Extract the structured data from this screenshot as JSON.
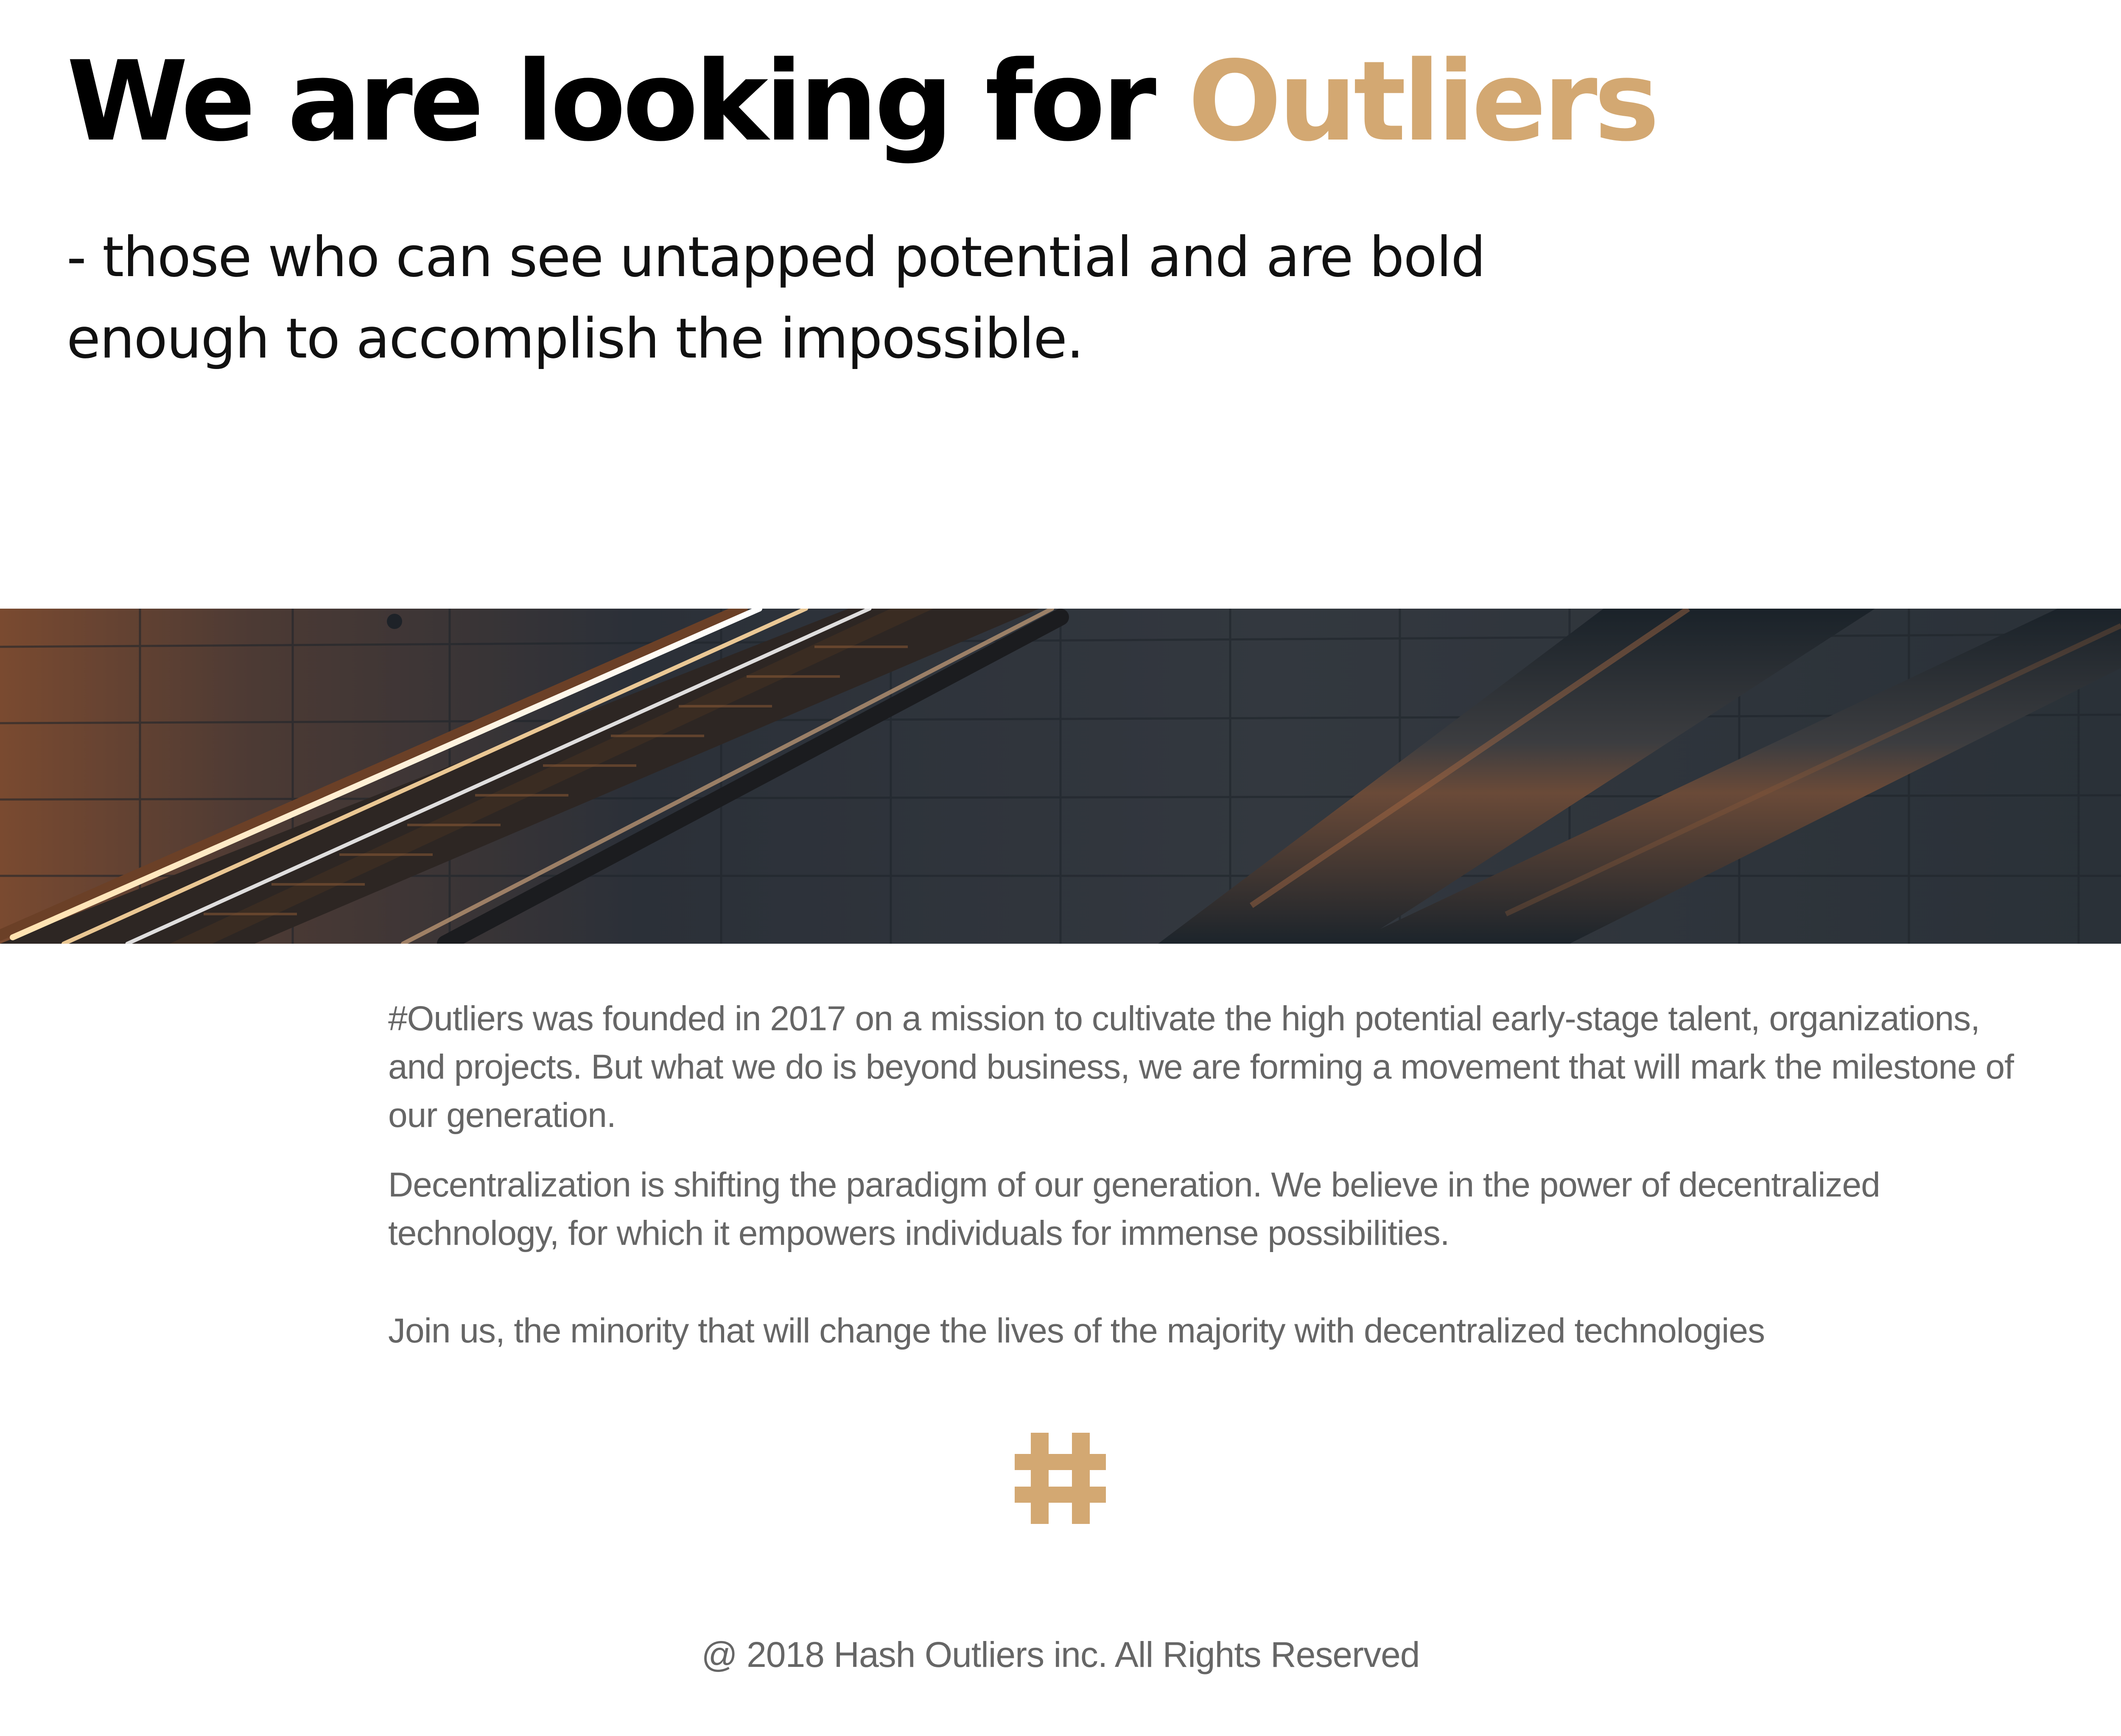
{
  "hero": {
    "title_main": "We are looking for ",
    "title_accent": "Outliers",
    "subtitle": "- those who can see untapped potential and are bold enough to accomplish the impossible."
  },
  "banner": {
    "image_subject": "escalator-photo"
  },
  "about": {
    "paragraph_1": "#Outliers was founded in 2017 on a mission to cultivate the high potential early-stage talent, organizations, and projects. But what we do is beyond business, we are forming a movement that will mark the milestone of our generation.",
    "paragraph_2": "Decentralization is shifting the paradigm of our generation. We believe in the power of decentralized technology, for which it empowers individuals for immense possibilities.",
    "paragraph_3": "Join us, the minority that will change the lives of the majority with decentralized technologies"
  },
  "logo": {
    "icon": "hash-icon"
  },
  "footer": {
    "copyright": "@ 2018 Hash Outliers inc. All Rights Reserved"
  },
  "colors": {
    "accent": "#d3a872",
    "heading": "#000000",
    "body_text": "#666666",
    "background": "#ffffff"
  }
}
